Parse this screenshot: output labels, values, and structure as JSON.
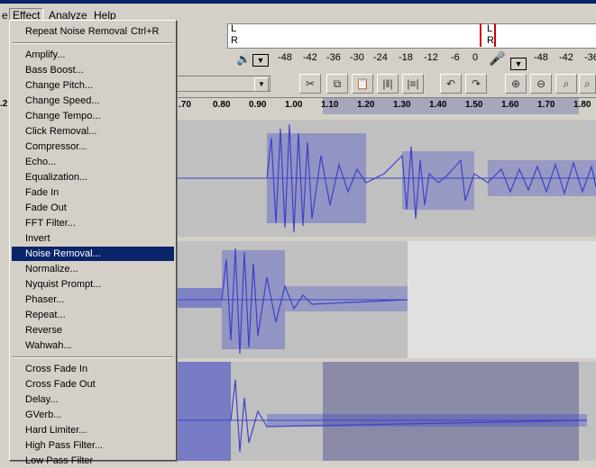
{
  "menubar": {
    "items": [
      "e",
      "Effect",
      "Analyze",
      "Help"
    ]
  },
  "menu": {
    "group1": [
      {
        "label": "Repeat Noise Removal",
        "shortcut": "Ctrl+R"
      }
    ],
    "group2": [
      "Amplify...",
      "Bass Boost...",
      "Change Pitch...",
      "Change Speed...",
      "Change Tempo...",
      "Click Removal...",
      "Compressor...",
      "Echo...",
      "Equalization...",
      "Fade In",
      "Fade Out",
      "FFT Filter...",
      "Invert",
      "Noise Removal...",
      "Normalize...",
      "Nyquist Prompt...",
      "Phaser...",
      "Repeat...",
      "Reverse",
      "Wahwah..."
    ],
    "group3": [
      "Cross Fade In",
      "Cross Fade Out",
      "Delay...",
      "GVerb...",
      "Hard Limiter...",
      "High Pass Filter...",
      "Low Pass Filter"
    ],
    "highlighted": "Noise Removal..."
  },
  "meters": {
    "channel_l": "L",
    "channel_r": "R",
    "play_ticks": [
      "-48",
      "-42",
      "-36",
      "-30",
      "-24",
      "-18",
      "-12",
      "-6",
      "0"
    ],
    "rec_ticks": [
      "-48",
      "-42",
      "-36"
    ]
  },
  "ruler": {
    "labels": [
      ".70",
      "0.80",
      "0.90",
      "1.00",
      "1.10",
      "1.20",
      "1.30",
      "1.40",
      "1.50",
      "1.60",
      "1.70",
      "1.80"
    ],
    "left_label": ".2",
    "selection": {
      "start": "1.10",
      "end": "1.80"
    }
  },
  "colors": {
    "waveform": "#3b43c9",
    "highlight": "#0a246a",
    "selection": "#a6a6bd"
  },
  "icons": [
    "speaker-icon",
    "microphone-icon",
    "scissors-icon",
    "copy-icon",
    "paste-icon",
    "trim-icon",
    "silence-icon",
    "undo-icon",
    "redo-icon",
    "zoom-in-icon",
    "zoom-out-icon",
    "fit-selection-icon",
    "fit-project-icon"
  ]
}
